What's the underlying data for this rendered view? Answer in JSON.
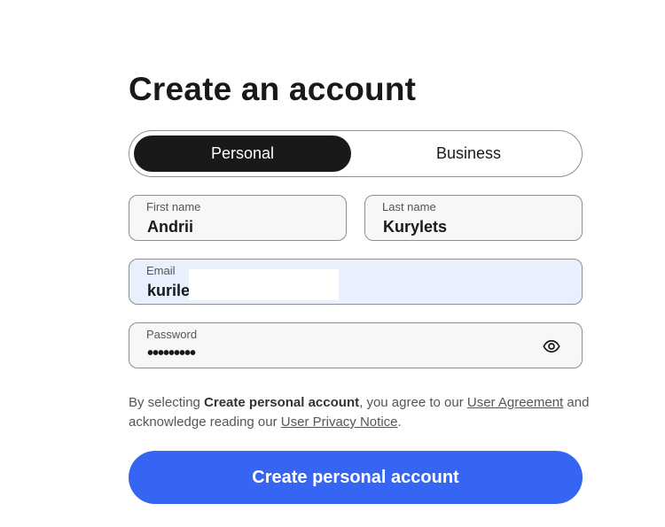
{
  "heading": "Create an account",
  "account_type": {
    "options": [
      "Personal",
      "Business"
    ],
    "selected": "Personal"
  },
  "form": {
    "first_name": {
      "label": "First name",
      "value": "Andrii"
    },
    "last_name": {
      "label": "Last name",
      "value": "Kurylets"
    },
    "email": {
      "label": "Email",
      "value": "kurile"
    },
    "password": {
      "label": "Password",
      "value": "•••••••••",
      "toggle_icon": "eye-icon"
    }
  },
  "legal": {
    "prefix": "By selecting ",
    "action_name": "Create personal account",
    "middle": ", you agree to our ",
    "agreement_link": "User Agreement",
    "middle2": " and acknowledge reading our ",
    "privacy_link": "User Privacy Notice",
    "suffix": "."
  },
  "submit_label": "Create personal account",
  "colors": {
    "primary": "#3665f3",
    "toggle_active_bg": "#191919",
    "email_focus_bg": "#e8f0fe"
  }
}
